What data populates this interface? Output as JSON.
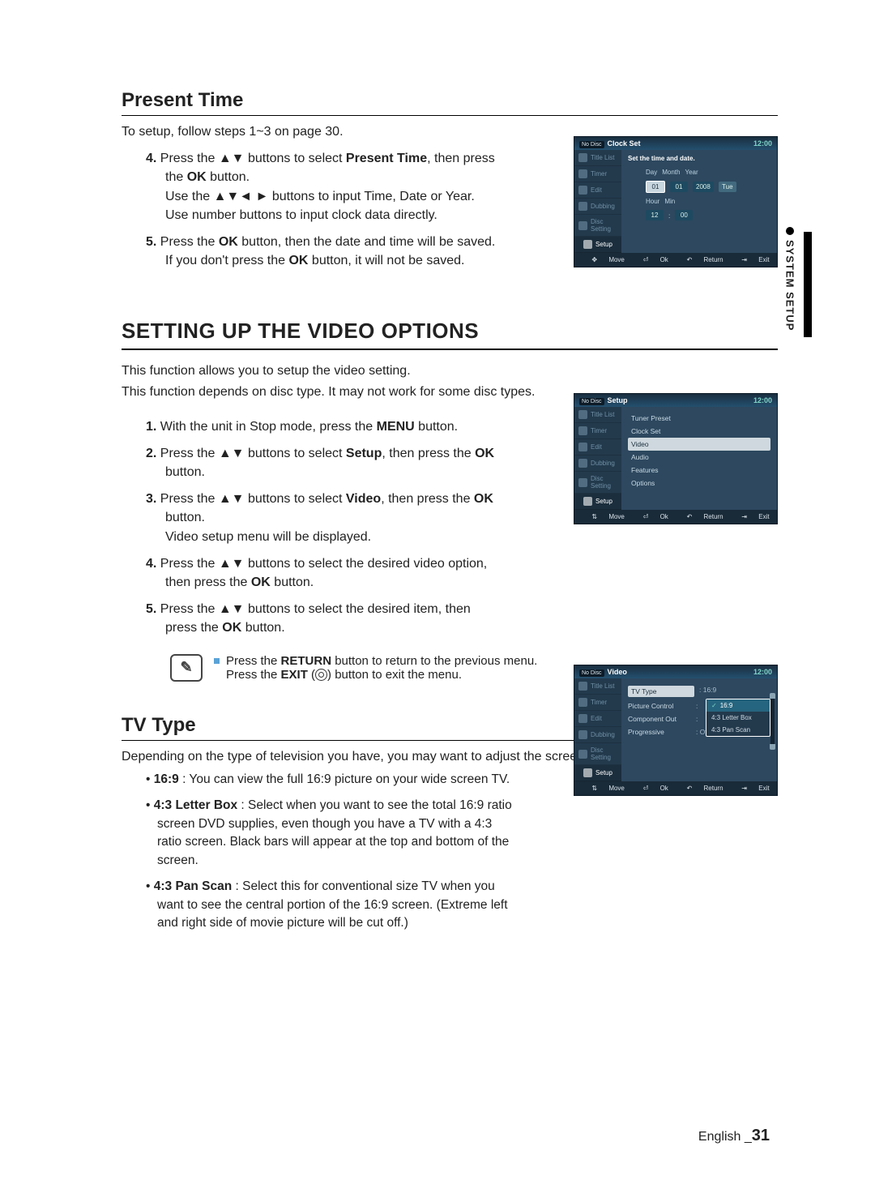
{
  "sideTab": "SYSTEM SETUP",
  "section1": {
    "title": "Present Time",
    "intro": "To setup, follow steps 1~3 on page 30.",
    "step4_a": "Press the ",
    "step4_b": " buttons to select ",
    "step4_label": "Present Time",
    "step4_c": ", then press the ",
    "ok": "OK",
    "step4_d": " button.",
    "step4_line2a": "Use the ",
    "step4_line2b": " buttons to input Time, Date or Year.",
    "step4_line3": "Use number buttons to input clock data directly.",
    "step5_a": "Press the ",
    "step5_b": " button, then the date and time will be saved.",
    "step5_c": "If you don't press the ",
    "step5_d": " button, it will not be saved."
  },
  "section2": {
    "title": "SETTING UP THE VIDEO OPTIONS",
    "intro1": "This function allows you to setup the video setting.",
    "intro2": "This function depends on disc type. It may not work for some disc types.",
    "s1_a": "With the unit in Stop mode, press the ",
    "menu": "MENU",
    "s1_b": " button.",
    "s2_a": "Press the ",
    "s2_b": " buttons to select ",
    "setup": "Setup",
    "s2_c": ", then press the ",
    "s2_d": " button.",
    "s3_a": "Press the ",
    "s3_b": " buttons to select ",
    "video": "Video",
    "s3_c": ", then press the ",
    "s3_d": " button.",
    "s3_line2": "Video setup menu will be displayed.",
    "s4_a": "Press the ",
    "s4_b": " buttons to select the desired video option, then press the ",
    "s4_c": " button.",
    "s5_a": "Press the ",
    "s5_b": " buttons to select the desired item, then press the ",
    "s5_c": " button.",
    "note1_a": "Press the ",
    "return": "RETURN",
    "note1_b": " button to return to the previous menu.",
    "note2_a": "Press the ",
    "exit": "EXIT",
    "note2_b": " button to exit the menu."
  },
  "section3": {
    "title": "TV Type",
    "intro": "Depending on the type of television you have, you may want to adjust the screen setting. (aspect ratio)",
    "b1_label": "16:9",
    "b1_text": " : You can view the full 16:9 picture on your wide screen TV.",
    "b2_label": "4:3 Letter Box",
    "b2_text": " : Select when you want to see the total 16:9 ratio screen DVD supplies, even though you have a TV with a 4:3 ratio screen. Black bars will appear at the top and bottom of the screen.",
    "b3_label": "4:3 Pan Scan",
    "b3_text": " : Select this for conventional size TV when you want to see the central portion of the 16:9 screen. (Extreme left and right side of movie picture will be cut off.)"
  },
  "arrows": {
    "ud": "▲▼",
    "udlr": "▲▼◄ ►"
  },
  "footer": {
    "lang": "English _",
    "page": "31"
  },
  "osd": {
    "noDisc": "No Disc",
    "time": "12:00",
    "nav": [
      "Title List",
      "Timer",
      "Edit",
      "Dubbing",
      "Disc Setting",
      "Setup"
    ],
    "footer": {
      "move": "Move",
      "ok": "Ok",
      "ret": "Return",
      "exit": "Exit"
    },
    "clock": {
      "title": "Clock Set",
      "prompt": "Set the time and date.",
      "labels": {
        "day": "Day",
        "month": "Month",
        "year": "Year",
        "hour": "Hour",
        "min": "Min"
      },
      "vals": {
        "day": "01",
        "month": "01",
        "year": "2008",
        "dow": "Tue",
        "hour": "12",
        "min": "00"
      }
    },
    "setup": {
      "title": "Setup",
      "items": [
        "Tuner Preset",
        "Clock Set",
        "Video",
        "Audio",
        "Features",
        "Options"
      ],
      "highlight": "Video"
    },
    "video": {
      "title": "Video",
      "rows": [
        {
          "k": "TV Type",
          "v": ": 16:9"
        },
        {
          "k": "Picture Control",
          "v": ":"
        },
        {
          "k": "Component Out",
          "v": ":"
        },
        {
          "k": "Progressive",
          "v": ": Off"
        }
      ],
      "popup": [
        "16:9",
        "4:3 Letter Box",
        "4:3 Pan Scan"
      ]
    }
  },
  "chart_data": null
}
